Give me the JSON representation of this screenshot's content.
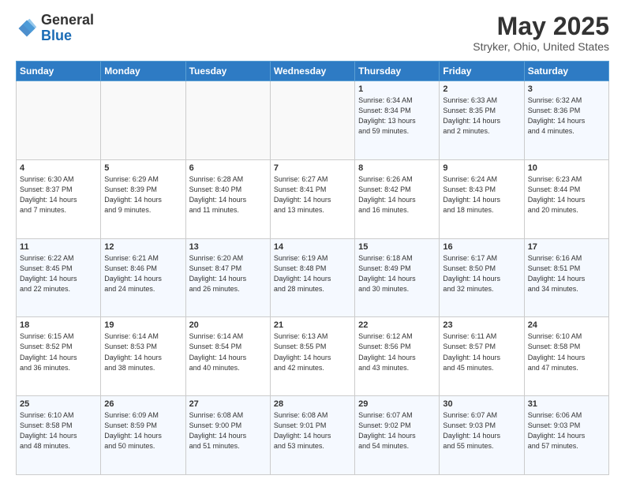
{
  "header": {
    "logo_general": "General",
    "logo_blue": "Blue",
    "main_title": "May 2025",
    "subtitle": "Stryker, Ohio, United States"
  },
  "calendar": {
    "days_of_week": [
      "Sunday",
      "Monday",
      "Tuesday",
      "Wednesday",
      "Thursday",
      "Friday",
      "Saturday"
    ],
    "weeks": [
      [
        {
          "day": "",
          "info": ""
        },
        {
          "day": "",
          "info": ""
        },
        {
          "day": "",
          "info": ""
        },
        {
          "day": "",
          "info": ""
        },
        {
          "day": "1",
          "info": "Sunrise: 6:34 AM\nSunset: 8:34 PM\nDaylight: 13 hours\nand 59 minutes."
        },
        {
          "day": "2",
          "info": "Sunrise: 6:33 AM\nSunset: 8:35 PM\nDaylight: 14 hours\nand 2 minutes."
        },
        {
          "day": "3",
          "info": "Sunrise: 6:32 AM\nSunset: 8:36 PM\nDaylight: 14 hours\nand 4 minutes."
        }
      ],
      [
        {
          "day": "4",
          "info": "Sunrise: 6:30 AM\nSunset: 8:37 PM\nDaylight: 14 hours\nand 7 minutes."
        },
        {
          "day": "5",
          "info": "Sunrise: 6:29 AM\nSunset: 8:39 PM\nDaylight: 14 hours\nand 9 minutes."
        },
        {
          "day": "6",
          "info": "Sunrise: 6:28 AM\nSunset: 8:40 PM\nDaylight: 14 hours\nand 11 minutes."
        },
        {
          "day": "7",
          "info": "Sunrise: 6:27 AM\nSunset: 8:41 PM\nDaylight: 14 hours\nand 13 minutes."
        },
        {
          "day": "8",
          "info": "Sunrise: 6:26 AM\nSunset: 8:42 PM\nDaylight: 14 hours\nand 16 minutes."
        },
        {
          "day": "9",
          "info": "Sunrise: 6:24 AM\nSunset: 8:43 PM\nDaylight: 14 hours\nand 18 minutes."
        },
        {
          "day": "10",
          "info": "Sunrise: 6:23 AM\nSunset: 8:44 PM\nDaylight: 14 hours\nand 20 minutes."
        }
      ],
      [
        {
          "day": "11",
          "info": "Sunrise: 6:22 AM\nSunset: 8:45 PM\nDaylight: 14 hours\nand 22 minutes."
        },
        {
          "day": "12",
          "info": "Sunrise: 6:21 AM\nSunset: 8:46 PM\nDaylight: 14 hours\nand 24 minutes."
        },
        {
          "day": "13",
          "info": "Sunrise: 6:20 AM\nSunset: 8:47 PM\nDaylight: 14 hours\nand 26 minutes."
        },
        {
          "day": "14",
          "info": "Sunrise: 6:19 AM\nSunset: 8:48 PM\nDaylight: 14 hours\nand 28 minutes."
        },
        {
          "day": "15",
          "info": "Sunrise: 6:18 AM\nSunset: 8:49 PM\nDaylight: 14 hours\nand 30 minutes."
        },
        {
          "day": "16",
          "info": "Sunrise: 6:17 AM\nSunset: 8:50 PM\nDaylight: 14 hours\nand 32 minutes."
        },
        {
          "day": "17",
          "info": "Sunrise: 6:16 AM\nSunset: 8:51 PM\nDaylight: 14 hours\nand 34 minutes."
        }
      ],
      [
        {
          "day": "18",
          "info": "Sunrise: 6:15 AM\nSunset: 8:52 PM\nDaylight: 14 hours\nand 36 minutes."
        },
        {
          "day": "19",
          "info": "Sunrise: 6:14 AM\nSunset: 8:53 PM\nDaylight: 14 hours\nand 38 minutes."
        },
        {
          "day": "20",
          "info": "Sunrise: 6:14 AM\nSunset: 8:54 PM\nDaylight: 14 hours\nand 40 minutes."
        },
        {
          "day": "21",
          "info": "Sunrise: 6:13 AM\nSunset: 8:55 PM\nDaylight: 14 hours\nand 42 minutes."
        },
        {
          "day": "22",
          "info": "Sunrise: 6:12 AM\nSunset: 8:56 PM\nDaylight: 14 hours\nand 43 minutes."
        },
        {
          "day": "23",
          "info": "Sunrise: 6:11 AM\nSunset: 8:57 PM\nDaylight: 14 hours\nand 45 minutes."
        },
        {
          "day": "24",
          "info": "Sunrise: 6:10 AM\nSunset: 8:58 PM\nDaylight: 14 hours\nand 47 minutes."
        }
      ],
      [
        {
          "day": "25",
          "info": "Sunrise: 6:10 AM\nSunset: 8:58 PM\nDaylight: 14 hours\nand 48 minutes."
        },
        {
          "day": "26",
          "info": "Sunrise: 6:09 AM\nSunset: 8:59 PM\nDaylight: 14 hours\nand 50 minutes."
        },
        {
          "day": "27",
          "info": "Sunrise: 6:08 AM\nSunset: 9:00 PM\nDaylight: 14 hours\nand 51 minutes."
        },
        {
          "day": "28",
          "info": "Sunrise: 6:08 AM\nSunset: 9:01 PM\nDaylight: 14 hours\nand 53 minutes."
        },
        {
          "day": "29",
          "info": "Sunrise: 6:07 AM\nSunset: 9:02 PM\nDaylight: 14 hours\nand 54 minutes."
        },
        {
          "day": "30",
          "info": "Sunrise: 6:07 AM\nSunset: 9:03 PM\nDaylight: 14 hours\nand 55 minutes."
        },
        {
          "day": "31",
          "info": "Sunrise: 6:06 AM\nSunset: 9:03 PM\nDaylight: 14 hours\nand 57 minutes."
        }
      ]
    ]
  }
}
